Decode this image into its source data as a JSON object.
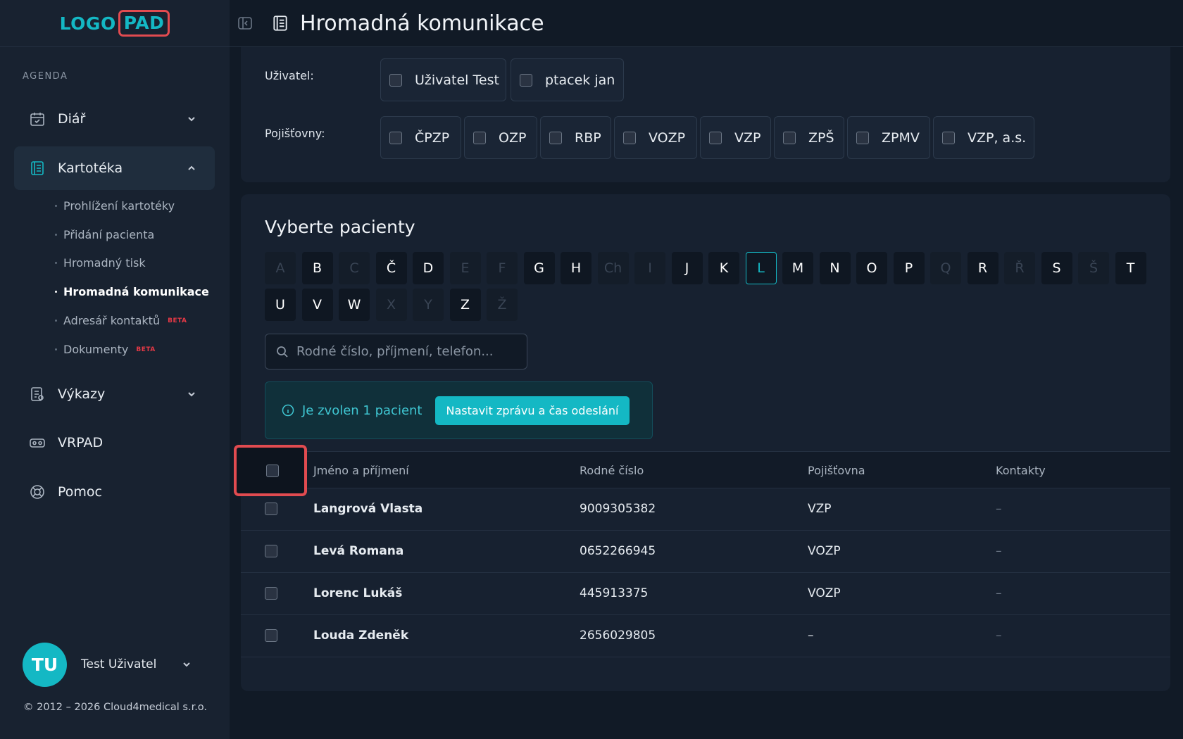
{
  "logo": {
    "part1": "LOGO",
    "part2": "PAD"
  },
  "sidebar": {
    "section_label": "AGENDA",
    "nav": [
      {
        "label": "Diář",
        "icon": "calendar-icon"
      },
      {
        "label": "Kartotéka",
        "icon": "card-file-icon"
      },
      {
        "label": "Výkazy",
        "icon": "report-icon"
      },
      {
        "label": "VRPAD",
        "icon": "vr-headset-icon"
      },
      {
        "label": "Pomoc",
        "icon": "lifebuoy-icon"
      }
    ],
    "sub": [
      {
        "label": "Prohlížení kartotéky"
      },
      {
        "label": "Přidání pacienta"
      },
      {
        "label": "Hromadný tisk"
      },
      {
        "label": "Hromadná komunikace"
      },
      {
        "label": "Adresář kontaktů",
        "badge": "BETA"
      },
      {
        "label": "Dokumenty",
        "badge": "BETA"
      }
    ],
    "user": {
      "initials": "TU",
      "name": "Test Uživatel"
    },
    "copyright": "© 2012 – 2026 Cloud4medical s.r.o."
  },
  "header": {
    "title": "Hromadná komunikace"
  },
  "filters": {
    "user_label": "Uživatel:",
    "users": [
      "Uživatel Test",
      "ptacek jan"
    ],
    "insurers_label": "Pojišťovny:",
    "insurers": [
      "ČPZP",
      "OZP",
      "RBP",
      "VOZP",
      "VZP",
      "ZPŠ",
      "ZPMV",
      "VZP, a.s."
    ]
  },
  "patients": {
    "title": "Vyberte pacienty",
    "letters": [
      {
        "ch": "A",
        "enabled": false
      },
      {
        "ch": "B",
        "enabled": true
      },
      {
        "ch": "C",
        "enabled": false
      },
      {
        "ch": "Č",
        "enabled": true
      },
      {
        "ch": "D",
        "enabled": true
      },
      {
        "ch": "E",
        "enabled": false
      },
      {
        "ch": "F",
        "enabled": false
      },
      {
        "ch": "G",
        "enabled": true
      },
      {
        "ch": "H",
        "enabled": true
      },
      {
        "ch": "Ch",
        "enabled": false
      },
      {
        "ch": "I",
        "enabled": false
      },
      {
        "ch": "J",
        "enabled": true
      },
      {
        "ch": "K",
        "enabled": true
      },
      {
        "ch": "L",
        "enabled": true,
        "selected": true
      },
      {
        "ch": "M",
        "enabled": true
      },
      {
        "ch": "N",
        "enabled": true
      },
      {
        "ch": "O",
        "enabled": true
      },
      {
        "ch": "P",
        "enabled": true
      },
      {
        "ch": "Q",
        "enabled": false
      },
      {
        "ch": "R",
        "enabled": true
      },
      {
        "ch": "Ř",
        "enabled": false
      },
      {
        "ch": "S",
        "enabled": true
      },
      {
        "ch": "Š",
        "enabled": false
      },
      {
        "ch": "T",
        "enabled": true
      },
      {
        "ch": "U",
        "enabled": true
      },
      {
        "ch": "V",
        "enabled": true
      },
      {
        "ch": "W",
        "enabled": true
      },
      {
        "ch": "X",
        "enabled": false
      },
      {
        "ch": "Y",
        "enabled": false
      },
      {
        "ch": "Z",
        "enabled": true
      },
      {
        "ch": "Ž",
        "enabled": false
      }
    ],
    "search_placeholder": "Rodné číslo, příjmení, telefon...",
    "info_text": "Je zvolen 1 pacient",
    "info_button": "Nastavit zprávu a čas odeslání",
    "columns": [
      "Jméno a příjmení",
      "Rodné číslo",
      "Pojišťovna",
      "Kontakty"
    ],
    "rows": [
      {
        "name": "Langrová Vlasta",
        "rc": "9009305382",
        "insurer": "VZP",
        "contacts": "–"
      },
      {
        "name": "Levá Romana",
        "rc": "0652266945",
        "insurer": "VOZP",
        "contacts": "–"
      },
      {
        "name": "Lorenc Lukáš",
        "rc": "445913375",
        "insurer": "VOZP",
        "contacts": "–"
      },
      {
        "name": "Louda Zdeněk",
        "rc": "2656029805",
        "insurer": "–",
        "contacts": "–"
      }
    ]
  },
  "colors": {
    "accent": "#14b8c4",
    "highlight": "#e14b50",
    "beta": "#e63946"
  }
}
